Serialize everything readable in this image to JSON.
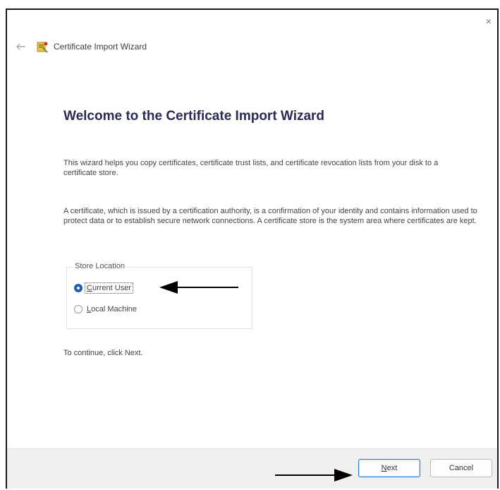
{
  "window": {
    "close_glyph": "×",
    "header_title": "Certificate Import Wizard"
  },
  "main": {
    "welcome_title": "Welcome to the Certificate Import Wizard",
    "paragraph1": "This wizard helps you copy certificates, certificate trust lists, and certificate revocation lists from your disk to a certificate store.",
    "paragraph2": "A certificate, which is issued by a certification authority, is a confirmation of your identity and contains information used to protect data or to establish secure network connections. A certificate store is the system area where certificates are kept.",
    "store_location": {
      "legend": "Store Location",
      "options": [
        {
          "label_first": "C",
          "label_rest": "urrent User",
          "selected": true
        },
        {
          "label_first": "L",
          "label_rest": "ocal Machine",
          "selected": false
        }
      ]
    },
    "continue_text": "To continue, click Next."
  },
  "footer": {
    "next_first": "N",
    "next_rest": "ext",
    "cancel_label": "Cancel"
  },
  "colors": {
    "accent": "#1f5fb3",
    "footer_bg": "#f0f0f0",
    "title": "#2a2a55"
  },
  "icons": {
    "back": "back-arrow-icon",
    "wizard": "certificate-wizard-icon",
    "close": "close-icon",
    "annotation": "annotation-arrow"
  }
}
